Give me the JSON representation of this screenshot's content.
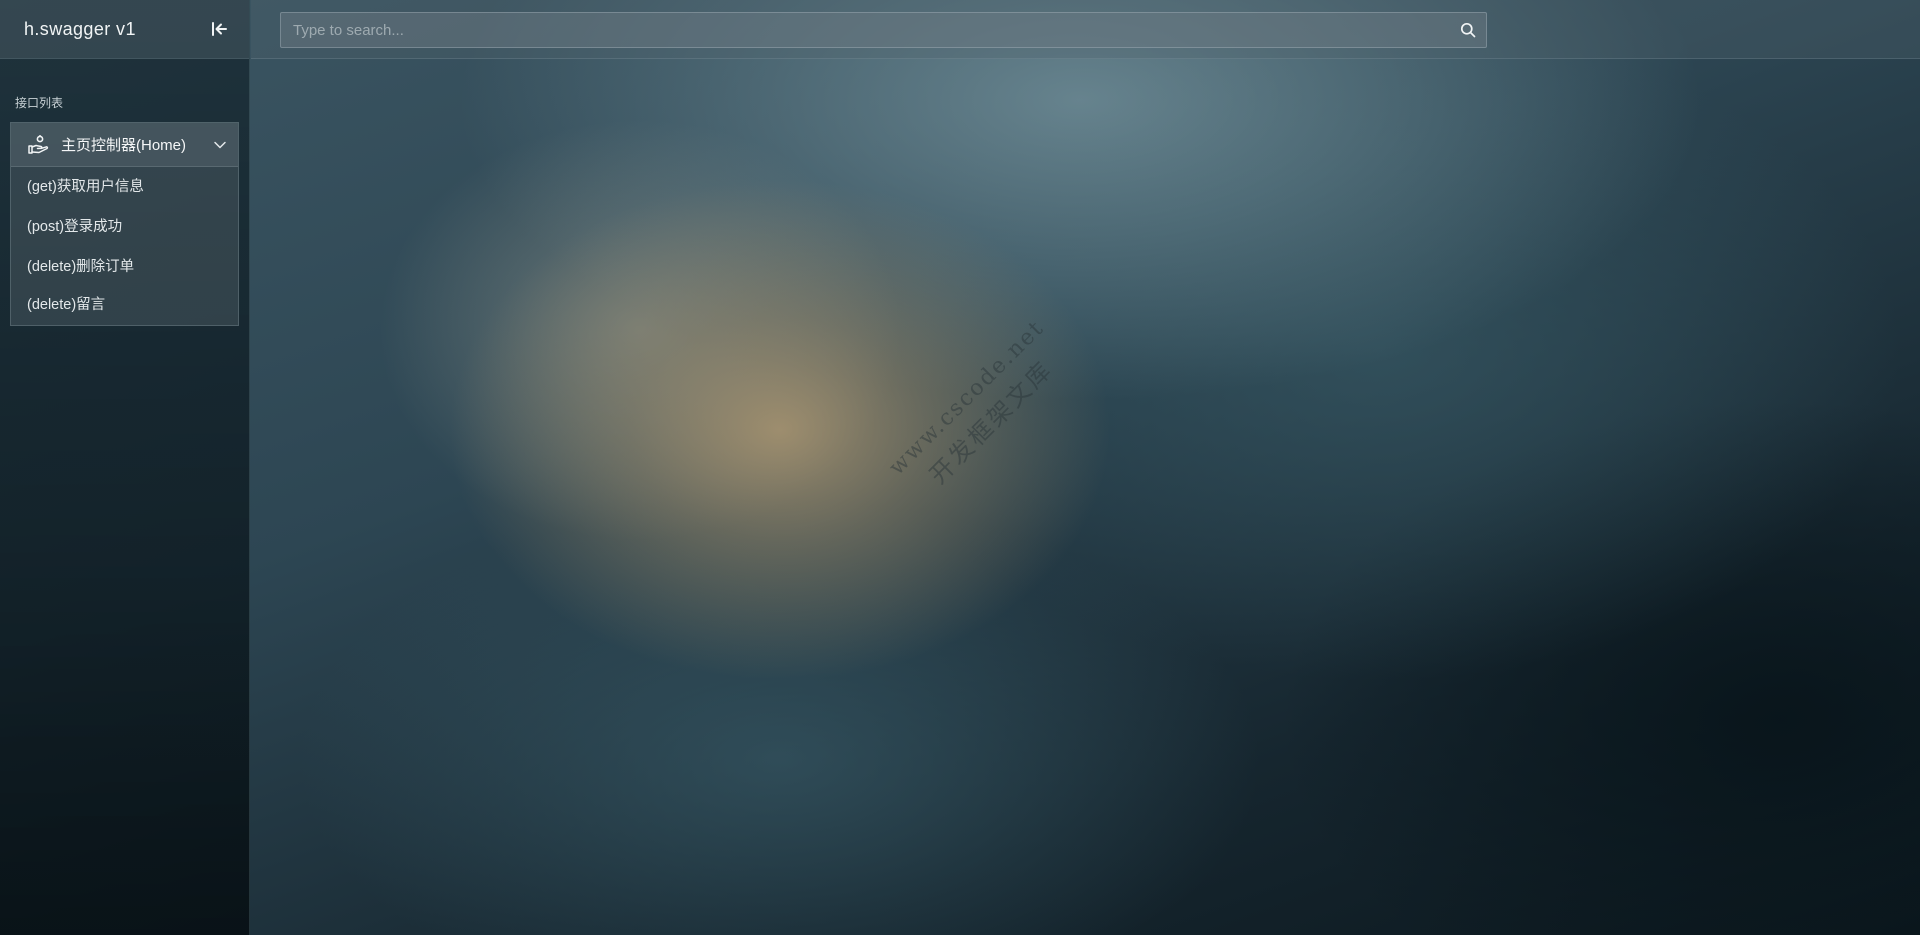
{
  "app": {
    "title": "h.swagger v1"
  },
  "search": {
    "placeholder": "Type to search...",
    "value": ""
  },
  "sidebar": {
    "section_label": "接口列表",
    "groups": [
      {
        "title": "主页控制器(Home)",
        "icon": "controller-hand-icon",
        "expanded": true,
        "items": [
          {
            "label": "(get)获取用户信息"
          },
          {
            "label": "(post)登录成功"
          },
          {
            "label": "(delete)删除订单"
          },
          {
            "label": "(delete)留言"
          }
        ]
      }
    ]
  },
  "watermark": {
    "line1": "www.cscode.net",
    "line2": "开发框架文库"
  },
  "icons": {
    "collapse": "collapse-left-icon",
    "search": "search-icon",
    "chevron": "chevron-down-icon"
  },
  "colors": {
    "text_primary": "#f1f4f5",
    "text_secondary": "#c9d2d6",
    "placeholder": "#9eaab0"
  }
}
